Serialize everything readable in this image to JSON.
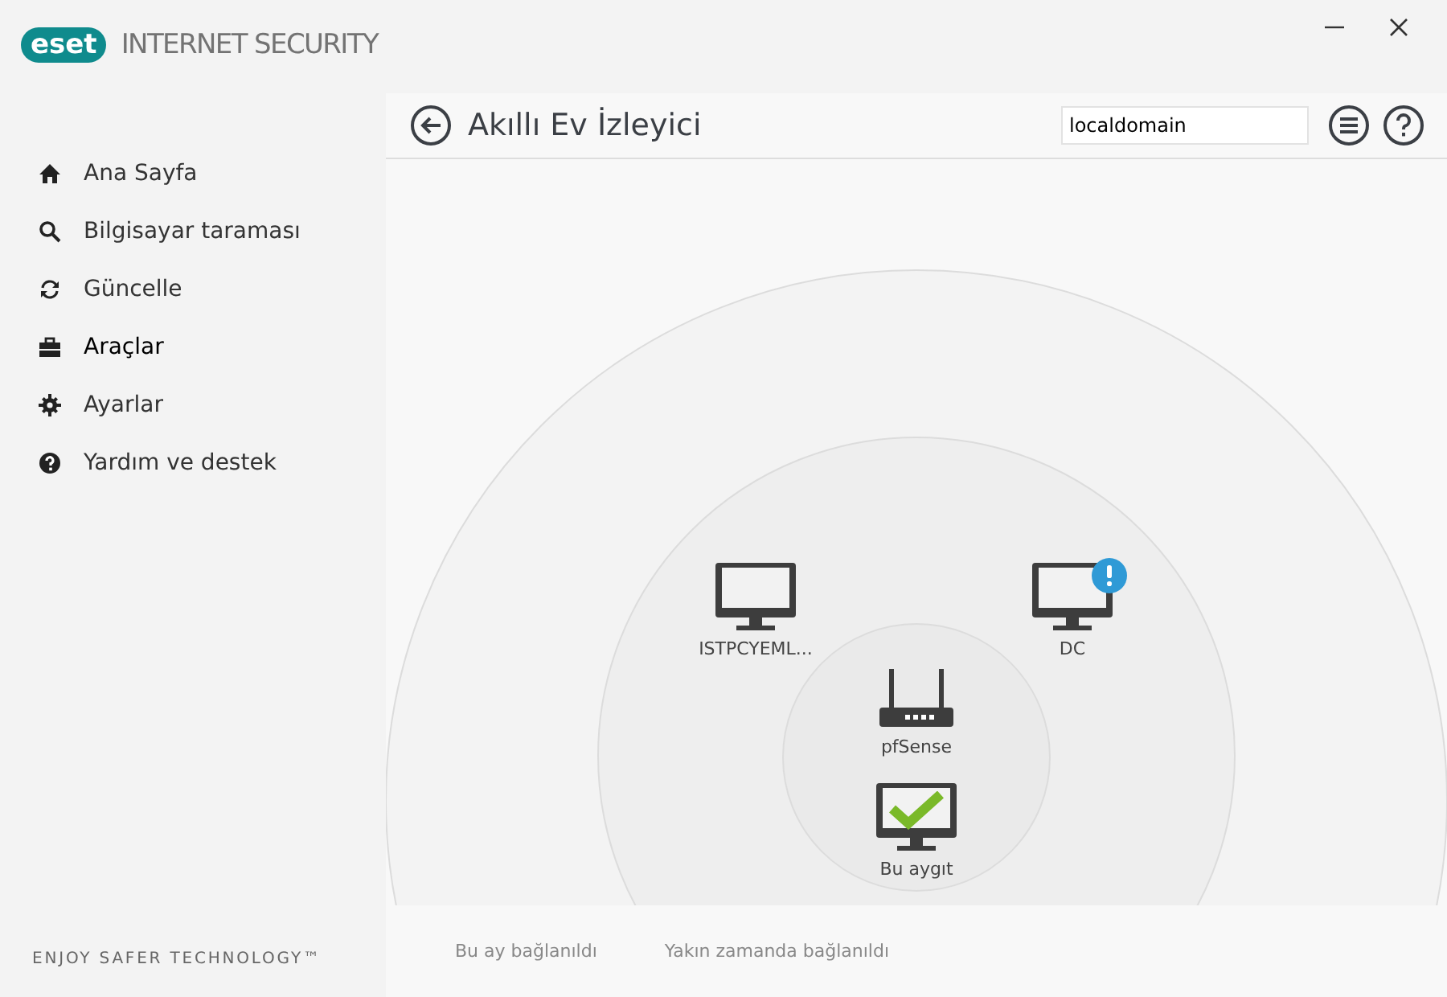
{
  "app": {
    "brand": "eset",
    "product": "INTERNET SECURITY"
  },
  "sidebar": {
    "items": [
      {
        "label": "Ana Sayfa",
        "selected": false
      },
      {
        "label": "Bilgisayar taraması",
        "selected": false
      },
      {
        "label": "Güncelle",
        "selected": false
      },
      {
        "label": "Araçlar",
        "selected": true
      },
      {
        "label": "Ayarlar",
        "selected": false
      },
      {
        "label": "Yardım ve destek",
        "selected": false
      }
    ],
    "footer": "ENJOY SAFER TECHNOLOGY™"
  },
  "header": {
    "title": "Akıllı Ev İzleyici",
    "search": {
      "value": "localdomain"
    }
  },
  "devices": [
    {
      "kind": "computer",
      "name": "ISTPCYEML...",
      "alert": false,
      "verified": false
    },
    {
      "kind": "computer",
      "name": "DC",
      "alert": true,
      "verified": false
    },
    {
      "kind": "router",
      "name": "pfSense",
      "alert": false,
      "verified": false
    },
    {
      "kind": "computer",
      "name": "Bu aygıt",
      "alert": false,
      "verified": true
    }
  ],
  "legend": [
    "Bu ay bağlanıldı",
    "Yakın zamanda bağlanıldı"
  ]
}
